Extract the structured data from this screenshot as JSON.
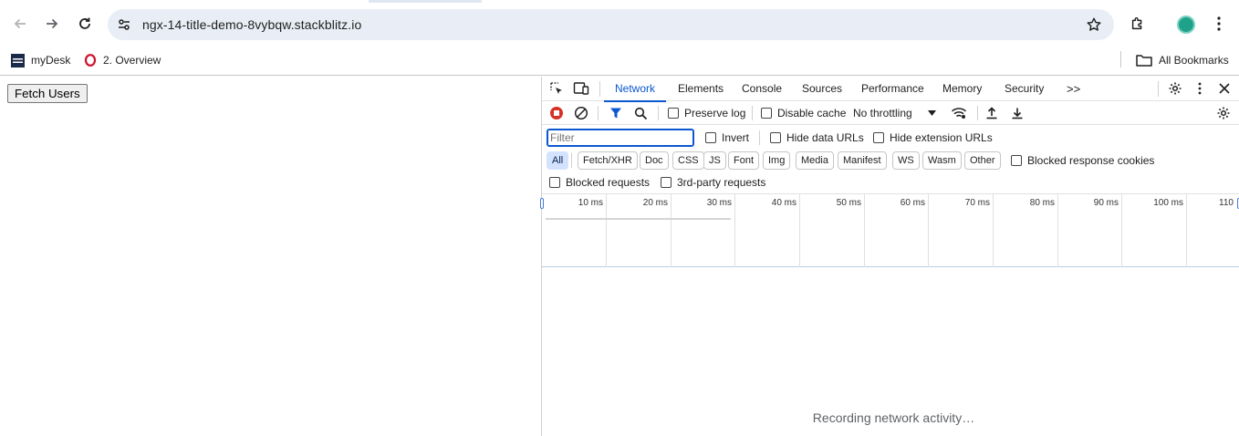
{
  "browser": {
    "url": "ngx-14-title-demo-8vybqw.stackblitz.io",
    "bookmarks": [
      {
        "label": "myDesk"
      },
      {
        "label": "2. Overview"
      }
    ],
    "all_bookmarks_label": "All Bookmarks",
    "profile_color": "#1fa28a"
  },
  "page": {
    "fetch_button_label": "Fetch Users"
  },
  "devtools": {
    "tabs": [
      "Network",
      "Elements",
      "Console",
      "Sources",
      "Performance",
      "Memory",
      "Security"
    ],
    "active_tab": "Network",
    "more_tabs_glyph": ">>",
    "toolbar": {
      "preserve_log": "Preserve log",
      "disable_cache": "Disable cache",
      "throttling": "No throttling"
    },
    "filter": {
      "placeholder": "Filter",
      "invert": "Invert",
      "hide_data_urls": "Hide data URLs",
      "hide_extension_urls": "Hide extension URLs",
      "types": [
        "All",
        "Fetch/XHR",
        "Doc",
        "CSS",
        "JS",
        "Font",
        "Img",
        "Media",
        "Manifest",
        "WS",
        "Wasm",
        "Other"
      ],
      "active_type": "All",
      "blocked_response_cookies": "Blocked response cookies",
      "blocked_requests": "Blocked requests",
      "third_party_requests": "3rd-party requests"
    },
    "timeline_ticks": [
      "10 ms",
      "20 ms",
      "30 ms",
      "40 ms",
      "50 ms",
      "60 ms",
      "70 ms",
      "80 ms",
      "90 ms",
      "100 ms",
      "110"
    ],
    "status_message": "Recording network activity…",
    "accent_color": "#0b57d0",
    "record_color": "#d93025"
  }
}
